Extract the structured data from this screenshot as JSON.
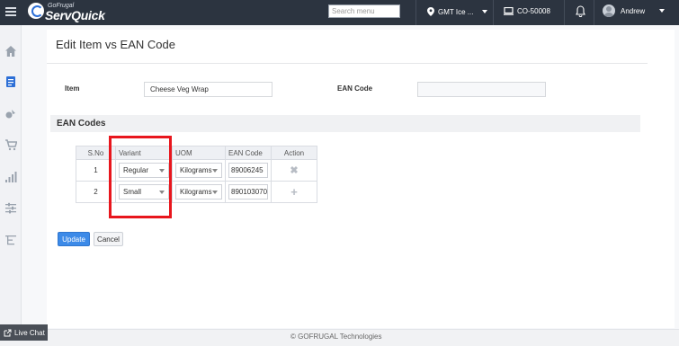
{
  "header": {
    "logo_small": "GoFrugal",
    "logo_main": "ServQuick",
    "search_placeholder": "Search menu",
    "location": "GMT Ice ...",
    "counter": "CO-50008",
    "user_name": "Andrew",
    "icons": [
      "menu-icon",
      "map-pin-icon",
      "computer-icon",
      "bell-icon",
      "avatar-icon"
    ]
  },
  "sidebar": {
    "icons": [
      "home-icon",
      "catalog-icon",
      "ingredients-icon",
      "cart-icon",
      "reports-icon",
      "settings-icon",
      "hierarchy-icon"
    ]
  },
  "page": {
    "title": "Edit Item vs EAN Code",
    "item_label": "Item",
    "item_value": "Cheese Veg Wrap",
    "ean_label": "EAN Code",
    "ean_value": ""
  },
  "ean_section": {
    "title": "EAN Codes",
    "columns": [
      "S.No",
      "Variant",
      "UOM",
      "EAN Code",
      "Action"
    ],
    "rows": [
      {
        "sno": "1",
        "variant": "Regular",
        "uom": "Kilograms",
        "ean": "89006245",
        "action": "✖"
      },
      {
        "sno": "2",
        "variant": "Small",
        "uom": "Kilograms",
        "ean": "890103070",
        "action": "+"
      }
    ]
  },
  "buttons": {
    "update": "Update",
    "cancel": "Cancel"
  },
  "footer": {
    "text": "© GOFRUGAL Technologies",
    "live_chat": "Live Chat"
  },
  "colors": {
    "topbar": "#2c3440",
    "primary_button": "#3c8ae8",
    "highlight": "#e8161d"
  }
}
